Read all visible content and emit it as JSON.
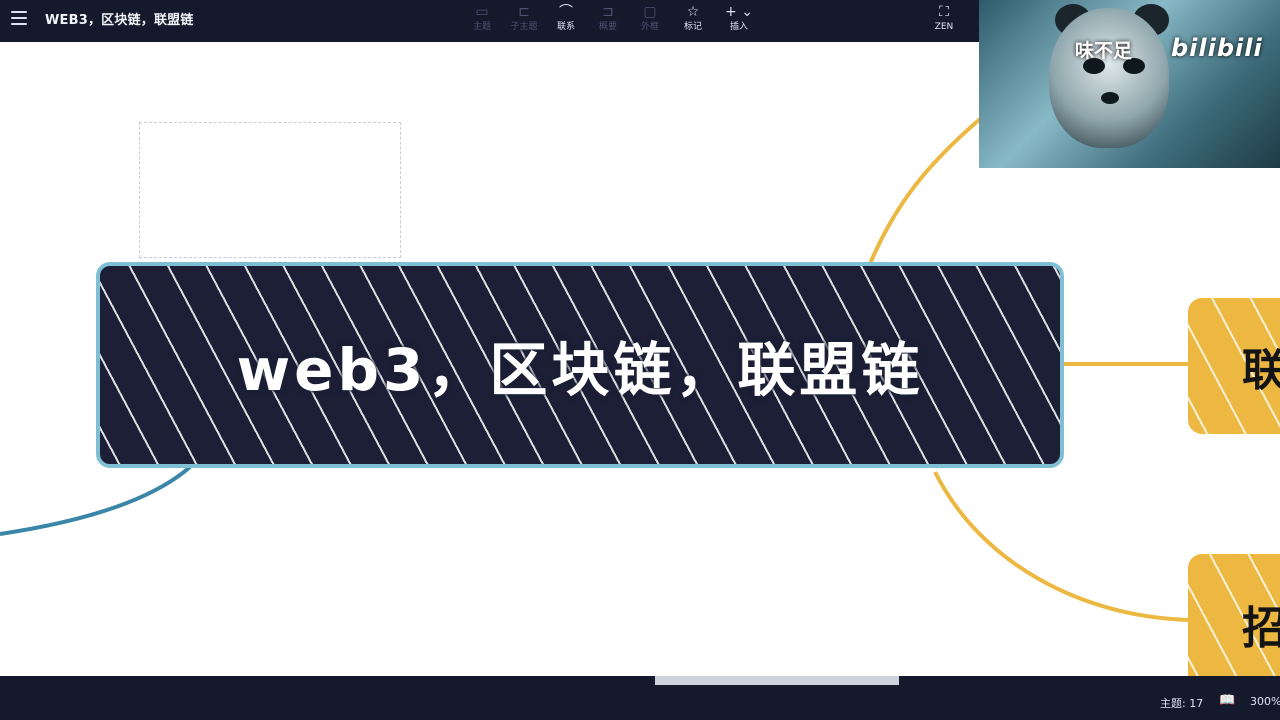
{
  "header": {
    "title": "WEB3，区块链，联盟链",
    "menu_icon": "hamburger-menu-icon",
    "tools": [
      {
        "label": "主题",
        "icon": "topic-icon",
        "enabled": false
      },
      {
        "label": "子主题",
        "icon": "subtopic-icon",
        "enabled": false
      },
      {
        "label": "联系",
        "icon": "relationship-icon",
        "enabled": true
      },
      {
        "label": "概要",
        "icon": "summary-icon",
        "enabled": false
      },
      {
        "label": "外框",
        "icon": "boundary-icon",
        "enabled": false
      },
      {
        "label": "标记",
        "icon": "star-icon",
        "enabled": true
      },
      {
        "label": "插入",
        "icon": "plus-icon",
        "enabled": true
      }
    ],
    "zen_label": "ZEN",
    "zen_icon": "fullscreen-icon"
  },
  "mindmap": {
    "central_topic": "web3，区块链，联盟链",
    "subtopics": [
      {
        "text": "联"
      },
      {
        "text": "招"
      }
    ],
    "colors": {
      "central_fill": "#1c1f35",
      "central_border": "#7ebfd3",
      "subtopic_fill": "#ecb842",
      "branch_yellow": "#ecb842",
      "branch_blue": "#3a86a8"
    }
  },
  "video_overlay": {
    "caption": "味不足",
    "brand": "bilibili"
  },
  "status": {
    "topic_count": "主题: 17",
    "book_icon": "book-icon",
    "zoom": "300%"
  }
}
